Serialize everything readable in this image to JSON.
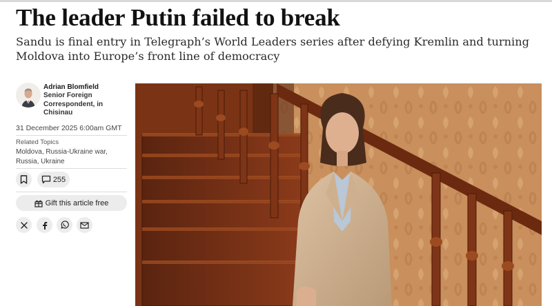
{
  "article": {
    "headline": "The leader Putin failed to break",
    "standfirst": "Sandu is final entry in Telegraph’s World Leaders series after defying Kremlin and turning Moldova into Europe’s front line of democracy"
  },
  "author": {
    "name": "Adrian Blomfield",
    "role": "Senior Foreign Correspondent, in Chisinau"
  },
  "date": "31 December 2025 6:00am GMT",
  "related": {
    "label": "Related Topics",
    "topics": [
      "Moldova",
      "Russia-Ukraine war",
      "Russia",
      "Ukraine"
    ]
  },
  "actions": {
    "save_icon": "bookmark-icon",
    "comments_icon": "comment-icon",
    "comments_count": "255",
    "gift_icon": "gift-icon",
    "gift_label": "Gift this article free"
  },
  "share": [
    "x-icon",
    "facebook-icon",
    "whatsapp-icon",
    "email-icon"
  ]
}
